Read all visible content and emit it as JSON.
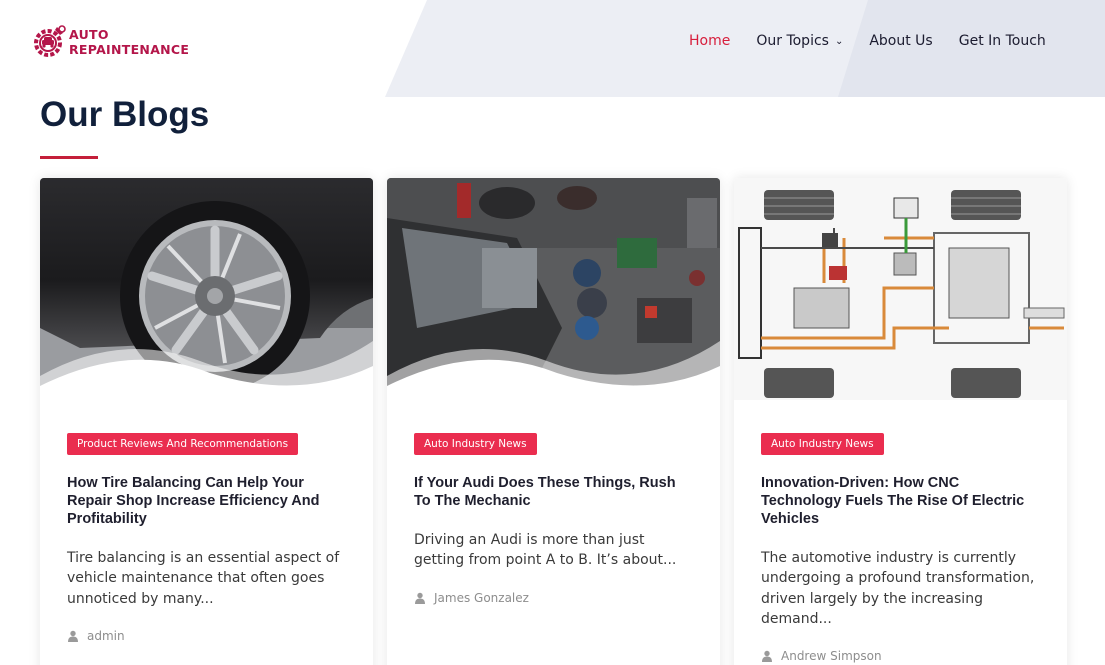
{
  "brand": {
    "line1": "AUTO",
    "line2": "REPAINTENANCE",
    "color": "#b4164a"
  },
  "nav": {
    "items": [
      {
        "label": "Home",
        "active": true
      },
      {
        "label": "Our Topics",
        "dropdown": true
      },
      {
        "label": "About Us"
      },
      {
        "label": "Get In Touch"
      }
    ]
  },
  "page": {
    "title": "Our Blogs",
    "accent": "#c41f3a"
  },
  "cards": [
    {
      "category": "Product Reviews And Recommendations",
      "title": "How Tire Balancing Can Help Your Repair Shop Increase Efficiency And Profitability",
      "excerpt": "Tire balancing is an essential aspect of vehicle maintenance that often goes unnoticed by many...",
      "author": "admin",
      "image": "car-wheel-photo"
    },
    {
      "category": "Auto Industry News",
      "title": "If Your Audi Does These Things, Rush To The Mechanic",
      "excerpt": "Driving an Audi is more than just getting from point A to B. It’s about...",
      "author": "James Gonzalez",
      "image": "mechanics-garage-photo"
    },
    {
      "category": "Auto Industry News",
      "title": "Innovation-Driven: How CNC Technology Fuels The Rise Of Electric Vehicles",
      "excerpt": "The automotive industry is currently undergoing a profound transformation, driven largely by the increasing demand...",
      "author": "Andrew Simpson",
      "image": "ev-powertrain-diagram"
    }
  ]
}
